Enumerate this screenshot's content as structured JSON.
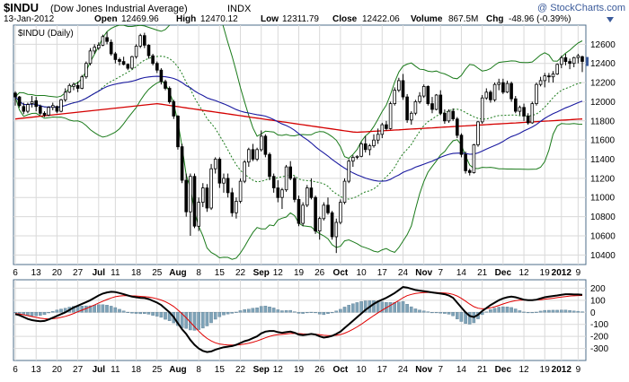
{
  "header": {
    "symbol": "$INDU",
    "name": "(Dow Jones Industrial Average)",
    "exchange": "INDX",
    "watermark": "@ StockCharts.com",
    "date": "13-Jan-2012",
    "open_label": "Open",
    "open": "12469.96",
    "high_label": "High",
    "high": "12470.12",
    "low_label": "Low",
    "low": "12311.79",
    "close_label": "Close",
    "close": "12422.06",
    "volume_label": "Volume",
    "volume": "867.5M",
    "chg_label": "Chg",
    "chg": "-48.96 (-0.39%)"
  },
  "colors": {
    "frame": "#4d6c8a",
    "up_candle": "#ffffff",
    "down_candle": "#000000",
    "bollinger": "#1a7a1a",
    "sma20": "#1a7a1a",
    "sma50": "#1a1aa0",
    "sma200": "#d40000",
    "macd": "#000000",
    "signal": "#e00000",
    "histogram": "#7fa3b8",
    "gap_fill": "#e8e8e8",
    "badge": "#3a5a9a"
  },
  "chart_data": [
    {
      "type": "candlestick",
      "title": "$INDU (Daily)",
      "ylim": [
        10300,
        12800
      ],
      "y_ticks": [
        10400,
        10600,
        10800,
        11000,
        11200,
        11400,
        11600,
        11800,
        12000,
        12200,
        12400,
        12600
      ],
      "grid": true,
      "x_tick_labels": [
        "6",
        "13",
        "20",
        "27",
        "Jul",
        "11",
        "18",
        "25",
        "Aug",
        "8",
        "15",
        "22",
        "Sep",
        "12",
        "19",
        "26",
        "Oct",
        "10",
        "17",
        "24",
        "Nov",
        "7",
        "14",
        "21",
        "Dec",
        "12",
        "19",
        "2012",
        "9"
      ],
      "x_tick_bold": [
        false,
        false,
        false,
        false,
        true,
        false,
        false,
        false,
        true,
        false,
        false,
        false,
        true,
        false,
        false,
        false,
        true,
        false,
        false,
        false,
        true,
        false,
        false,
        false,
        true,
        false,
        false,
        true,
        false
      ],
      "x_tick_index": [
        0,
        5,
        10,
        15,
        20,
        24,
        29,
        34,
        39,
        44,
        49,
        54,
        59,
        63,
        68,
        73,
        78,
        83,
        88,
        93,
        98,
        102,
        107,
        112,
        117,
        122,
        127,
        131,
        135
      ],
      "ohlc": [
        [
          12090,
          12110,
          11960,
          12050
        ],
        [
          12050,
          12060,
          11940,
          11960
        ],
        [
          11950,
          11990,
          11870,
          11900
        ],
        [
          11900,
          11990,
          11880,
          11970
        ],
        [
          11980,
          12060,
          11940,
          12000
        ],
        [
          12010,
          12050,
          11900,
          11950
        ],
        [
          11950,
          11970,
          11860,
          11880
        ],
        [
          11880,
          11900,
          11840,
          11860
        ],
        [
          11860,
          11950,
          11850,
          11940
        ],
        [
          11940,
          11990,
          11910,
          11960
        ],
        [
          11950,
          11960,
          11880,
          11900
        ],
        [
          11900,
          12030,
          11890,
          12020
        ],
        [
          12020,
          12140,
          12000,
          12100
        ],
        [
          12100,
          12190,
          12090,
          12170
        ],
        [
          12160,
          12200,
          12120,
          12180
        ],
        [
          12170,
          12210,
          12100,
          12140
        ],
        [
          12140,
          12280,
          12130,
          12260
        ],
        [
          12260,
          12420,
          12240,
          12400
        ],
        [
          12400,
          12560,
          12380,
          12530
        ],
        [
          12530,
          12600,
          12500,
          12570
        ],
        [
          12560,
          12620,
          12540,
          12590
        ],
        [
          12590,
          12700,
          12580,
          12680
        ],
        [
          12670,
          12730,
          12600,
          12630
        ],
        [
          12620,
          12650,
          12480,
          12500
        ],
        [
          12500,
          12520,
          12400,
          12440
        ],
        [
          12440,
          12460,
          12380,
          12420
        ],
        [
          12420,
          12470,
          12380,
          12390
        ],
        [
          12390,
          12400,
          12330,
          12350
        ],
        [
          12350,
          12480,
          12340,
          12470
        ],
        [
          12470,
          12600,
          12450,
          12580
        ],
        [
          12580,
          12710,
          12560,
          12690
        ],
        [
          12690,
          12720,
          12560,
          12590
        ],
        [
          12590,
          12600,
          12450,
          12480
        ],
        [
          12480,
          12500,
          12380,
          12400
        ],
        [
          12400,
          12420,
          12300,
          12330
        ],
        [
          12330,
          12350,
          12180,
          12210
        ],
        [
          12210,
          12230,
          12120,
          12140
        ],
        [
          12140,
          12160,
          11980,
          12000
        ],
        [
          12000,
          12020,
          11820,
          11850
        ],
        [
          11850,
          11860,
          11500,
          11530
        ],
        [
          11530,
          11560,
          11150,
          11180
        ],
        [
          11180,
          11250,
          10800,
          10850
        ],
        [
          10850,
          11250,
          10600,
          11220
        ],
        [
          11220,
          11250,
          10680,
          10700
        ],
        [
          10700,
          11000,
          10650,
          10950
        ],
        [
          10950,
          11150,
          10900,
          11100
        ],
        [
          11100,
          11140,
          10850,
          10890
        ],
        [
          10890,
          11350,
          10870,
          11300
        ],
        [
          11300,
          11420,
          11250,
          11400
        ],
        [
          11400,
          11420,
          11100,
          11150
        ],
        [
          11150,
          11250,
          11050,
          11200
        ],
        [
          11200,
          11250,
          11000,
          11050
        ],
        [
          11050,
          11100,
          10800,
          10840
        ],
        [
          10840,
          11000,
          10780,
          10960
        ],
        [
          10960,
          11200,
          10940,
          11170
        ],
        [
          11170,
          11390,
          11150,
          11370
        ],
        [
          11370,
          11520,
          11320,
          11500
        ],
        [
          11500,
          11560,
          11380,
          11400
        ],
        [
          11400,
          11520,
          11380,
          11500
        ],
        [
          11500,
          11700,
          11480,
          11640
        ],
        [
          11640,
          11660,
          11420,
          11450
        ],
        [
          11450,
          11470,
          11180,
          11220
        ],
        [
          11220,
          11250,
          11050,
          11100
        ],
        [
          11100,
          11180,
          10950,
          11000
        ],
        [
          11000,
          11100,
          10880,
          11080
        ],
        [
          11080,
          11340,
          11060,
          11320
        ],
        [
          11320,
          11380,
          11180,
          11200
        ],
        [
          11200,
          11220,
          10950,
          10980
        ],
        [
          10980,
          11020,
          10700,
          10730
        ],
        [
          10730,
          10950,
          10700,
          10920
        ],
        [
          10920,
          11130,
          10900,
          11100
        ],
        [
          11100,
          11200,
          10980,
          11000
        ],
        [
          11000,
          11020,
          10620,
          10650
        ],
        [
          10650,
          10800,
          10560,
          10780
        ],
        [
          10780,
          10950,
          10760,
          10920
        ],
        [
          10920,
          11000,
          10820,
          10840
        ],
        [
          10840,
          10860,
          10560,
          10590
        ],
        [
          10590,
          10780,
          10420,
          10740
        ],
        [
          10740,
          10980,
          10720,
          10950
        ],
        [
          10950,
          11200,
          10930,
          11170
        ],
        [
          11170,
          11400,
          11150,
          11380
        ],
        [
          11380,
          11440,
          11320,
          11420
        ],
        [
          11420,
          11440,
          11400,
          11430
        ],
        [
          11430,
          11580,
          11420,
          11560
        ],
        [
          11560,
          11640,
          11470,
          11500
        ],
        [
          11500,
          11560,
          11440,
          11540
        ],
        [
          11540,
          11660,
          11520,
          11600
        ],
        [
          11600,
          11720,
          11560,
          11660
        ],
        [
          11660,
          11780,
          11620,
          11760
        ],
        [
          11760,
          11800,
          11700,
          11720
        ],
        [
          11720,
          12000,
          11710,
          11980
        ],
        [
          11980,
          12150,
          11960,
          12120
        ],
        [
          12120,
          12250,
          12100,
          12220
        ],
        [
          12220,
          12290,
          12020,
          12050
        ],
        [
          12050,
          12080,
          11780,
          11810
        ],
        [
          11810,
          11900,
          11760,
          11880
        ],
        [
          11880,
          12020,
          11860,
          12000
        ],
        [
          12000,
          12100,
          11980,
          12060
        ],
        [
          12060,
          12180,
          12040,
          12160
        ],
        [
          12160,
          12170,
          11960,
          11980
        ],
        [
          11980,
          12050,
          11880,
          11920
        ],
        [
          11920,
          12080,
          11910,
          12070
        ],
        [
          12070,
          12120,
          11860,
          11880
        ],
        [
          11880,
          11920,
          11770,
          11800
        ],
        [
          11800,
          11920,
          11780,
          11900
        ],
        [
          11900,
          11930,
          11800,
          11820
        ],
        [
          11820,
          11840,
          11620,
          11650
        ],
        [
          11650,
          11670,
          11420,
          11450
        ],
        [
          11450,
          11480,
          11250,
          11280
        ],
        [
          11280,
          11300,
          11230,
          11260
        ],
        [
          11260,
          11560,
          11250,
          11550
        ],
        [
          11550,
          11800,
          11530,
          11790
        ],
        [
          11790,
          12070,
          11770,
          12040
        ],
        [
          12040,
          12140,
          12020,
          12100
        ],
        [
          12100,
          12120,
          11990,
          12020
        ],
        [
          12020,
          12200,
          12000,
          12180
        ],
        [
          12180,
          12240,
          12120,
          12200
        ],
        [
          12200,
          12240,
          12080,
          12100
        ],
        [
          12100,
          12220,
          12090,
          12190
        ],
        [
          12190,
          12210,
          12000,
          12030
        ],
        [
          12030,
          12060,
          11880,
          11900
        ],
        [
          11900,
          11960,
          11860,
          11940
        ],
        [
          11940,
          11980,
          11800,
          11850
        ],
        [
          11850,
          11880,
          11760,
          11780
        ],
        [
          11780,
          12000,
          11770,
          11980
        ],
        [
          11980,
          12200,
          11960,
          12180
        ],
        [
          12180,
          12260,
          12160,
          12220
        ],
        [
          12220,
          12300,
          12150,
          12270
        ],
        [
          12270,
          12300,
          12200,
          12260
        ],
        [
          12260,
          12320,
          12200,
          12290
        ],
        [
          12290,
          12400,
          12280,
          12390
        ],
        [
          12390,
          12480,
          12350,
          12460
        ],
        [
          12460,
          12500,
          12380,
          12420
        ],
        [
          12420,
          12450,
          12340,
          12400
        ],
        [
          12400,
          12470,
          12360,
          12460
        ],
        [
          12460,
          12500,
          12400,
          12480
        ],
        [
          12470,
          12480,
          12310,
          12420
        ]
      ]
    },
    {
      "type": "line",
      "indicator": "MACD",
      "ylim": [
        -400,
        270
      ],
      "y_ticks": [
        -300,
        -200,
        -100,
        0,
        100,
        200
      ],
      "grid": true,
      "macd": [
        -15,
        -25,
        -40,
        -55,
        -65,
        -70,
        -75,
        -72,
        -60,
        -45,
        -30,
        -15,
        0,
        20,
        40,
        55,
        70,
        85,
        100,
        120,
        140,
        155,
        165,
        170,
        168,
        160,
        150,
        140,
        130,
        125,
        120,
        118,
        110,
        95,
        80,
        60,
        30,
        0,
        -40,
        -90,
        -140,
        -180,
        -230,
        -270,
        -300,
        -320,
        -330,
        -325,
        -310,
        -300,
        -290,
        -285,
        -280,
        -270,
        -255,
        -240,
        -230,
        -215,
        -200,
        -175,
        -160,
        -155,
        -155,
        -165,
        -170,
        -165,
        -160,
        -170,
        -185,
        -190,
        -185,
        -180,
        -185,
        -200,
        -210,
        -205,
        -195,
        -180,
        -160,
        -130,
        -100,
        -70,
        -40,
        -10,
        20,
        45,
        70,
        90,
        105,
        120,
        140,
        160,
        185,
        210,
        205,
        195,
        185,
        180,
        175,
        170,
        165,
        160,
        155,
        150,
        140,
        120,
        80,
        40,
        0,
        -30,
        -40,
        -20,
        10,
        35,
        60,
        80,
        100,
        115,
        125,
        130,
        125,
        115,
        105,
        100,
        100,
        105,
        115,
        125,
        130,
        135,
        140,
        145,
        150,
        150,
        148,
        148,
        145
      ],
      "signal": [
        -10,
        -15,
        -20,
        -28,
        -35,
        -42,
        -49,
        -53,
        -55,
        -53,
        -49,
        -42,
        -34,
        -23,
        -10,
        4,
        18,
        32,
        46,
        61,
        77,
        92,
        106,
        119,
        129,
        135,
        138,
        139,
        137,
        135,
        132,
        129,
        126,
        120,
        112,
        102,
        88,
        70,
        48,
        20,
        -12,
        -46,
        -83,
        -120,
        -156,
        -189,
        -217,
        -238,
        -253,
        -263,
        -268,
        -271,
        -272,
        -272,
        -269,
        -263,
        -256,
        -248,
        -238,
        -225,
        -212,
        -200,
        -191,
        -186,
        -183,
        -180,
        -176,
        -175,
        -177,
        -180,
        -181,
        -181,
        -182,
        -186,
        -191,
        -194,
        -194,
        -191,
        -185,
        -174,
        -159,
        -141,
        -121,
        -99,
        -75,
        -51,
        -27,
        -4,
        18,
        38,
        58,
        78,
        99,
        121,
        138,
        149,
        156,
        161,
        164,
        165,
        165,
        164,
        162,
        160,
        156,
        149,
        135,
        116,
        93,
        68,
        47,
        34,
        29,
        31,
        37,
        46,
        57,
        69,
        80,
        90,
        97,
        101,
        102,
        102,
        102,
        103,
        105,
        109,
        113,
        117,
        122,
        126,
        131,
        135,
        137,
        139,
        140
      ],
      "histogram_sign": "macd minus signal"
    }
  ]
}
